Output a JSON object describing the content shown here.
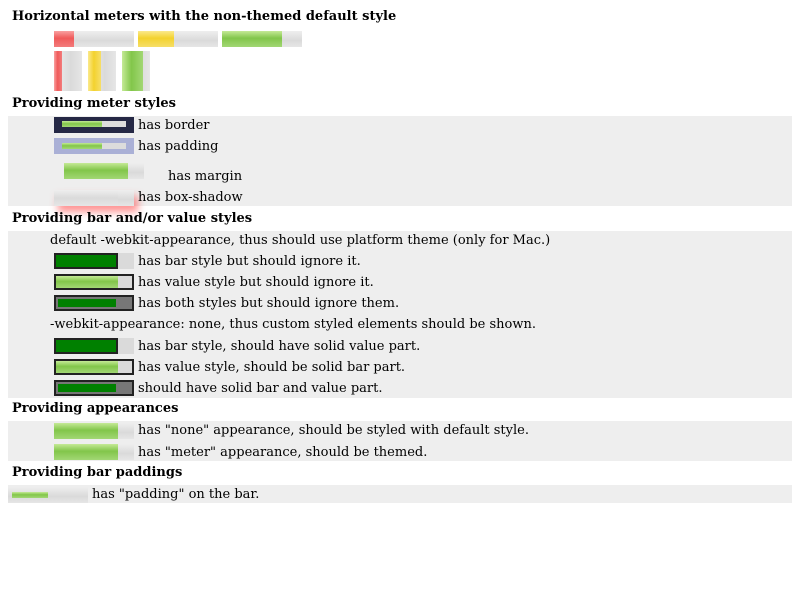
{
  "sections": {
    "s1": {
      "title": "Horizontal meters with the non-themed default style"
    },
    "s2": {
      "title": "Providing meter styles",
      "items": [
        "has border",
        "has padding",
        "has margin",
        "has box-shadow"
      ]
    },
    "s3": {
      "title": "Providing bar and/or value styles",
      "note_default": "default -webkit-appearance, thus should use platform theme (only for Mac.)",
      "items_default": [
        "has bar style but should ignore it.",
        "has value style but should ignore it.",
        "has both styles but should ignore them."
      ],
      "note_none": "-webkit-appearance: none, thus custom styled elements should be shown.",
      "items_none": [
        "has bar style, should have solid value part.",
        "has value style, should be solid bar part.",
        "should have solid bar and value part."
      ]
    },
    "s4": {
      "title": "Providing appearances",
      "items": [
        "has \"none\" appearance, should be styled with default style.",
        "has \"meter\" appearance, should be themed."
      ]
    },
    "s5": {
      "title": "Providing bar paddings",
      "items": [
        "has \"padding\" on the bar."
      ]
    }
  },
  "meter_levels": {
    "horizontal": [
      0.25,
      0.45,
      0.75
    ],
    "vertical": [
      0.25,
      0.45,
      0.75
    ],
    "styled": 0.8
  },
  "colors": {
    "band": "#eeeeee",
    "low": "#f05a5a",
    "medium": "#f3d22e",
    "optimum": "#82c64a",
    "solid_bar": "#008000",
    "border_dark": "#252845",
    "padding_bg": "#aab0d6"
  }
}
